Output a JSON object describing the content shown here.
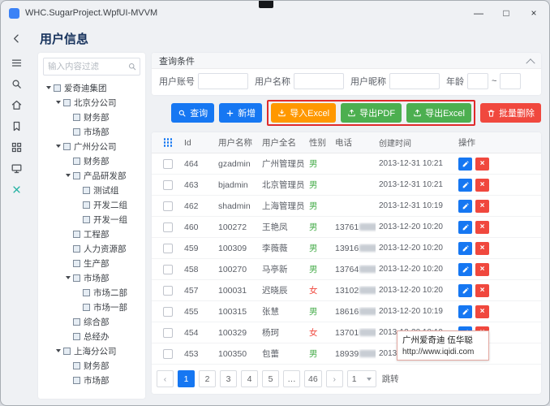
{
  "window": {
    "title": "WHC.SugarProject.WpfUI-MVVM"
  },
  "icons": {
    "minimize": "—",
    "maximize": "□",
    "close": "×",
    "prev": "‹",
    "next": "›"
  },
  "colors": {
    "primary": "#1677f2",
    "success": "#4caf50",
    "warning": "#ff9800",
    "danger": "#f0483e",
    "highlight_box": "#e02b2b",
    "page_title": "#16325c",
    "gender_male": "#4caf50",
    "gender_female": "#f0483e"
  },
  "page": {
    "title": "用户信息"
  },
  "sidebar": {
    "filter_placeholder": "输入内容过滤",
    "tree": [
      {
        "label": "爱奇迪集团",
        "level": 0,
        "expanded": true
      },
      {
        "label": "北京分公司",
        "level": 1,
        "expanded": true
      },
      {
        "label": "财务部",
        "level": 2
      },
      {
        "label": "市场部",
        "level": 2
      },
      {
        "label": "广州分公司",
        "level": 1,
        "expanded": true
      },
      {
        "label": "财务部",
        "level": 2
      },
      {
        "label": "产品研发部",
        "level": 2,
        "expanded": true
      },
      {
        "label": "测试组",
        "level": 3
      },
      {
        "label": "开发二组",
        "level": 3
      },
      {
        "label": "开发一组",
        "level": 3
      },
      {
        "label": "工程部",
        "level": 2
      },
      {
        "label": "人力资源部",
        "level": 2
      },
      {
        "label": "生产部",
        "level": 2
      },
      {
        "label": "市场部",
        "level": 2,
        "expanded": true
      },
      {
        "label": "市场二部",
        "level": 3
      },
      {
        "label": "市场一部",
        "level": 3
      },
      {
        "label": "综合部",
        "level": 2
      },
      {
        "label": "总经办",
        "level": 2
      },
      {
        "label": "上海分公司",
        "level": 1,
        "expanded": true
      },
      {
        "label": "财务部",
        "level": 2
      },
      {
        "label": "市场部",
        "level": 2
      }
    ]
  },
  "query": {
    "title": "查询条件",
    "account_label": "用户账号",
    "name_label": "用户名称",
    "nickname_label": "用户昵称",
    "age_label": "年龄",
    "age_separator": "~"
  },
  "toolbar": {
    "search": "查询",
    "add": "新增",
    "import_excel": "导入Excel",
    "export_pdf": "导出PDF",
    "export_excel": "导出Excel",
    "batch_delete": "批量删除"
  },
  "table": {
    "columns": {
      "id": "Id",
      "username": "用户名称",
      "fullname": "用户全名",
      "gender": "性别",
      "phone": "电话",
      "created": "创建时间",
      "actions": "操作"
    },
    "rows": [
      {
        "id": "464",
        "username": "gzadmin",
        "fullname": "广州管理员",
        "gender": "男",
        "phone": "",
        "created": "2013-12-31 10:21"
      },
      {
        "id": "463",
        "username": "bjadmin",
        "fullname": "北京管理员",
        "gender": "男",
        "phone": "",
        "created": "2013-12-31 10:21"
      },
      {
        "id": "462",
        "username": "shadmin",
        "fullname": "上海管理员",
        "gender": "男",
        "phone": "",
        "created": "2013-12-31 10:19"
      },
      {
        "id": "460",
        "username": "100272",
        "fullname": "王艳凤",
        "gender": "男",
        "phone": "13761",
        "created": "2013-12-20 10:20"
      },
      {
        "id": "459",
        "username": "100309",
        "fullname": "李薇薇",
        "gender": "男",
        "phone": "13916",
        "created": "2013-12-20 10:20"
      },
      {
        "id": "458",
        "username": "100270",
        "fullname": "马亭新",
        "gender": "男",
        "phone": "13764",
        "created": "2013-12-20 10:20"
      },
      {
        "id": "457",
        "username": "100031",
        "fullname": "迟晓辰",
        "gender": "女",
        "phone": "13102",
        "created": "2013-12-20 10:20"
      },
      {
        "id": "455",
        "username": "100315",
        "fullname": "张慧",
        "gender": "男",
        "phone": "18616",
        "created": "2013-12-20 10:19"
      },
      {
        "id": "454",
        "username": "100329",
        "fullname": "杨珂",
        "gender": "女",
        "phone": "13701",
        "created": "2013-12-20 10:19"
      },
      {
        "id": "453",
        "username": "100350",
        "fullname": "包蕾",
        "gender": "男",
        "phone": "18939",
        "created": "2013-1"
      }
    ]
  },
  "pagination": {
    "pages": [
      "1",
      "2",
      "3",
      "4",
      "5",
      "…",
      "46"
    ],
    "current": "1",
    "size_value": "1",
    "jump_label": "跳转"
  },
  "watermark": {
    "line1": "广州爱奇迪 伍华聪",
    "line2": "http://www.iqidi.com"
  }
}
